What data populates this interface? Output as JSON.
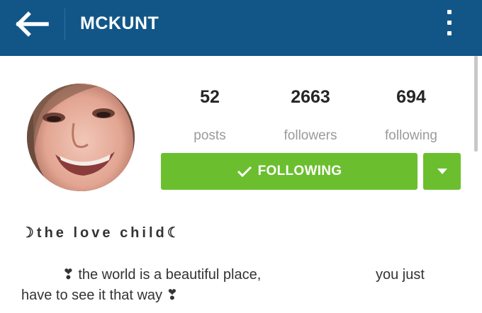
{
  "header": {
    "title": "MCKUNT",
    "background_color": "#125688",
    "back_icon": "arrow-left-icon",
    "menu_icon": "more-vertical-icon"
  },
  "profile": {
    "avatar": "profile-photo",
    "stats": {
      "posts": {
        "value": "52",
        "label": "posts"
      },
      "followers": {
        "value": "2663",
        "label": "followers"
      },
      "following": {
        "value": "694",
        "label": "following"
      }
    },
    "follow_button": {
      "label": "FOLLOWING",
      "icon": "checkmark-icon",
      "color": "#6bbf2e"
    },
    "dropdown_icon": "caret-down-icon",
    "full_name": "☽the love child☾",
    "bio": {
      "line1_part1": "❣ the world is a beautiful place,",
      "line1_part2": "you just",
      "line2": "have to see it that way ❣"
    }
  }
}
